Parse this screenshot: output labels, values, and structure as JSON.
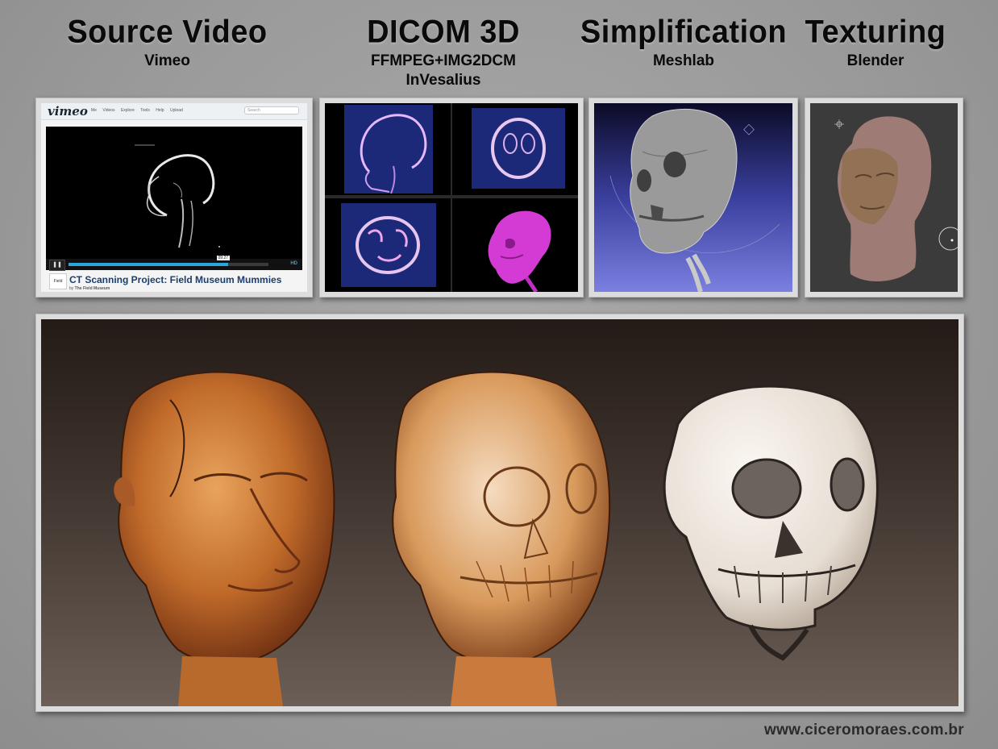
{
  "headings": [
    {
      "title": "Source Video",
      "tools": [
        "Vimeo"
      ]
    },
    {
      "title": "DICOM 3D",
      "tools": [
        "FFMPEG+IMG2DCM",
        "InVesalius"
      ]
    },
    {
      "title": "Simplification",
      "tools": [
        "Meshlab"
      ]
    },
    {
      "title": "Texturing",
      "tools": [
        "Blender"
      ]
    }
  ],
  "vimeo": {
    "logo": "vimeo",
    "nav": [
      "Me",
      "Videos",
      "Explore",
      "Tools",
      "Help",
      "Upload"
    ],
    "search_placeholder": "Search",
    "timecode": "09:27",
    "hd": "HD",
    "badge": "Field",
    "video_title": "CT Scanning Project: Field Museum Mummies",
    "byline_prefix": "by",
    "byline_author": "The Field Museum"
  },
  "credit": "www.ciceromoraes.com.br"
}
